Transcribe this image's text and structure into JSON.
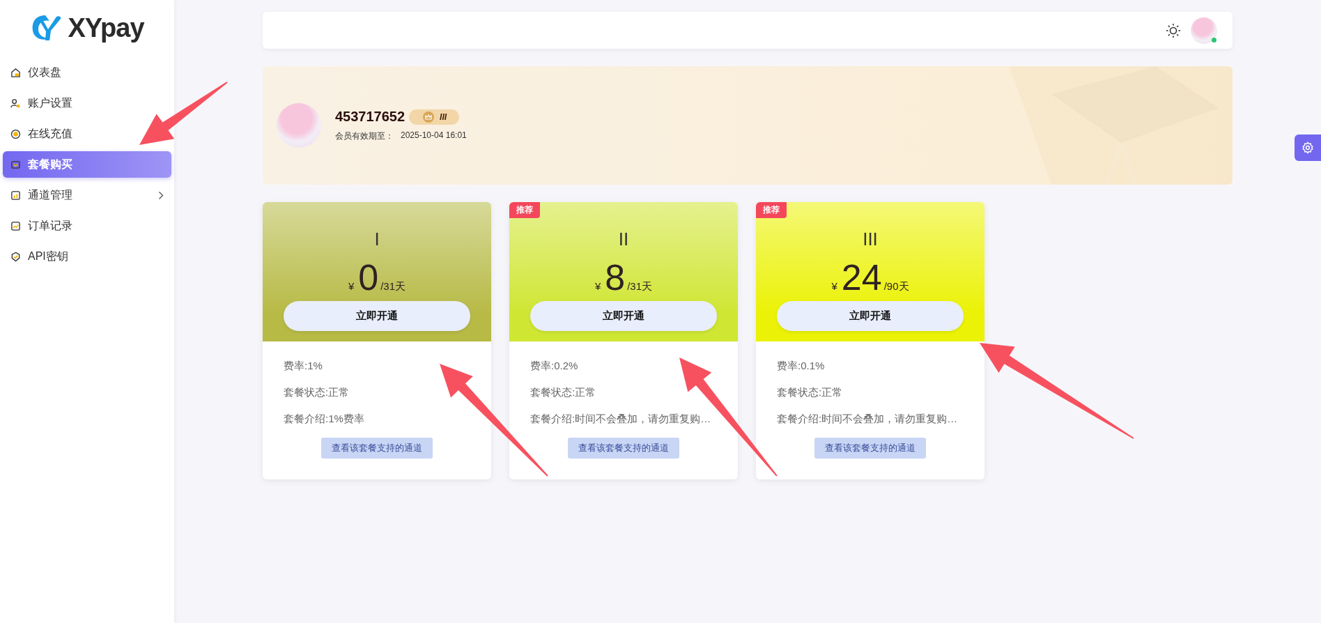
{
  "logo": {
    "text": "XYpay"
  },
  "sidebar": {
    "items": [
      {
        "label": "仪表盘",
        "selected": false,
        "has_submenu": false
      },
      {
        "label": "账户设置",
        "selected": false,
        "has_submenu": false
      },
      {
        "label": "在线充值",
        "selected": false,
        "has_submenu": false
      },
      {
        "label": "套餐购买",
        "selected": true,
        "has_submenu": false
      },
      {
        "label": "通道管理",
        "selected": false,
        "has_submenu": true
      },
      {
        "label": "订单记录",
        "selected": false,
        "has_submenu": false
      },
      {
        "label": "API密钥",
        "selected": false,
        "has_submenu": false
      }
    ]
  },
  "header": {
    "avatar": {
      "online": true
    }
  },
  "profile": {
    "user_id": "453717652",
    "level": "III",
    "expiry_label": "会员有效期至：",
    "expiry": "2025-10-04 16:01"
  },
  "plans": [
    {
      "name": "I",
      "currency": "¥",
      "price": "0",
      "period": "/31天",
      "button": "立即开通",
      "color": "#b7ba45",
      "details": [
        "费率:1%",
        "套餐状态:正常",
        "套餐介绍:1%费率"
      ],
      "channels_button": "查看该套餐支持的通道"
    },
    {
      "name": "II",
      "badge": "推荐",
      "currency": "¥",
      "price": "8",
      "period": "/31天",
      "button": "立即开通",
      "color": "#cfe633",
      "details": [
        "费率:0.2%",
        "套餐状态:正常",
        "套餐介绍:时间不会叠加，请勿重复购…"
      ],
      "channels_button": "查看该套餐支持的通道"
    },
    {
      "name": "III",
      "badge": "推荐",
      "currency": "¥",
      "price": "24",
      "period": "/90天",
      "button": "立即开通",
      "color": "#ebf205",
      "details": [
        "费率:0.1%",
        "套餐状态:正常",
        "套餐介绍:时间不会叠加，请勿重复购…"
      ],
      "channels_button": "查看该套餐支持的通道"
    }
  ]
}
